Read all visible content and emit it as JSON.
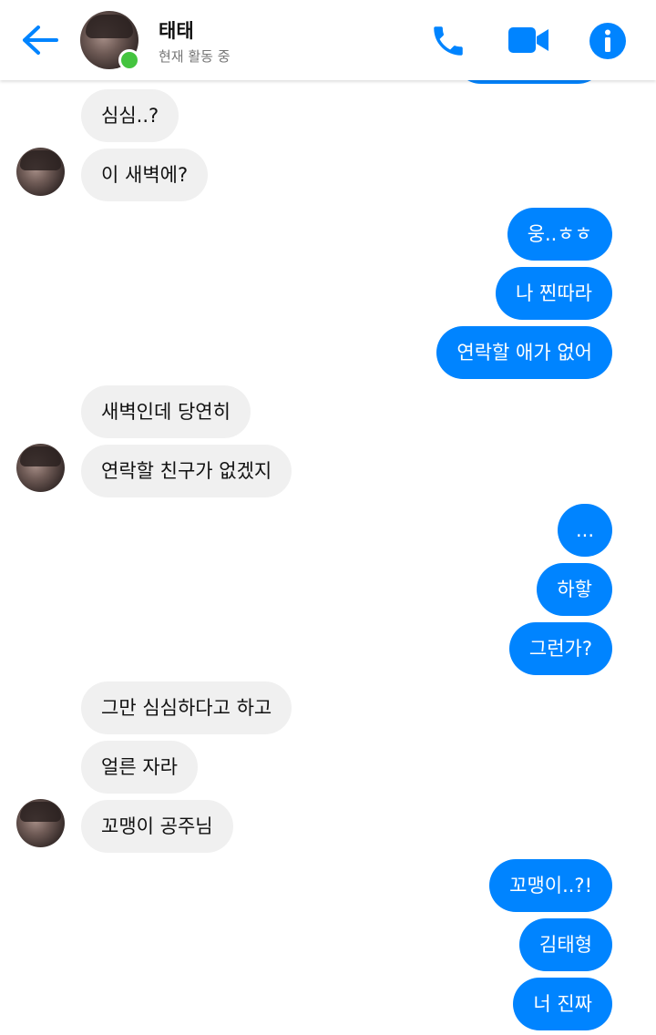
{
  "header": {
    "contact_name": "태태",
    "status": "현재 활동 중",
    "icons": {
      "back": "back-arrow-icon",
      "call": "phone-icon",
      "video": "video-camera-icon",
      "info": "info-icon"
    }
  },
  "colors": {
    "accent": "#0084ff",
    "incoming_bubble": "#f0f0f0",
    "online": "#44c43f"
  },
  "messages": [
    {
      "dir": "in",
      "text": "심심..?"
    },
    {
      "dir": "in",
      "text": "이 새벽에?"
    },
    {
      "dir": "out",
      "text": "웅..ㅎㅎ"
    },
    {
      "dir": "out",
      "text": "나 찐따라"
    },
    {
      "dir": "out",
      "text": "연락할 애가 없어"
    },
    {
      "dir": "in",
      "text": "새벽인데 당연히"
    },
    {
      "dir": "in",
      "text": "연락할 친구가 없겠지"
    },
    {
      "dir": "out",
      "text": "..."
    },
    {
      "dir": "out",
      "text": "하핳"
    },
    {
      "dir": "out",
      "text": "그런가?"
    },
    {
      "dir": "in",
      "text": "그만 심심하다고 하고"
    },
    {
      "dir": "in",
      "text": "얼른 자라"
    },
    {
      "dir": "in",
      "text": "꼬맹이 공주님"
    },
    {
      "dir": "out",
      "text": "꼬맹이..?!"
    },
    {
      "dir": "out",
      "text": "김태형"
    },
    {
      "dir": "out",
      "text": "너 진짜"
    }
  ]
}
